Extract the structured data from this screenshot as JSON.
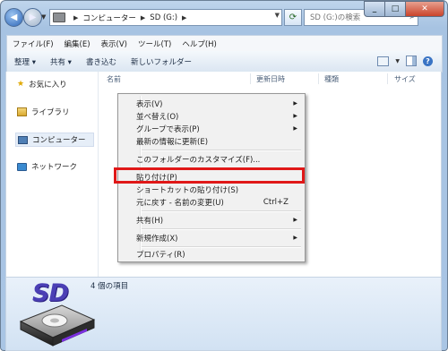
{
  "address": {
    "crumbs": [
      "コンピューター",
      "SD (G:)"
    ]
  },
  "search": {
    "placeholder": "SD (G:)の検索"
  },
  "menubar": [
    "ファイル(F)",
    "編集(E)",
    "表示(V)",
    "ツール(T)",
    "ヘルプ(H)"
  ],
  "commandbar": {
    "organize": "整理 ▾",
    "share": "共有 ▾",
    "burn": "書き込む",
    "new_folder": "新しいフォルダー"
  },
  "nav": {
    "favorites": "お気に入り",
    "libraries": "ライブラリ",
    "computer": "コンピューター",
    "network": "ネットワーク"
  },
  "columns": {
    "name": "名前",
    "modified": "更新日時",
    "type": "種類",
    "size": "サイズ"
  },
  "context_menu": {
    "view": "表示(V)",
    "sort": "並べ替え(O)",
    "group": "グループで表示(P)",
    "refresh": "最新の情報に更新(E)",
    "customize": "このフォルダーのカスタマイズ(F)...",
    "paste": "貼り付け(P)",
    "paste_shortcut": "ショートカットの貼り付け(S)",
    "undo": "元に戻す - 名前の変更(U)",
    "undo_shortcut": "Ctrl+Z",
    "share": "共有(H)",
    "new": "新規作成(X)",
    "properties": "プロパティ(R)"
  },
  "details": {
    "count": "4 個の項目",
    "logo": "SD"
  },
  "colors": {
    "highlight": "#e01818",
    "sd_purple": "#4b3fb5"
  }
}
